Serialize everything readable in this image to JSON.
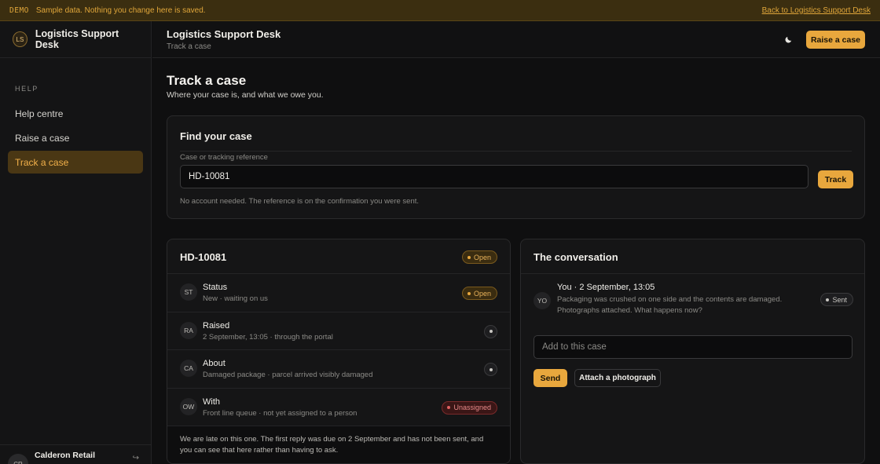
{
  "demo": {
    "tag": "DEMO",
    "text": "Sample data. Nothing you change here is saved.",
    "back_link": "Back to Logistics Support Desk"
  },
  "brand": {
    "initials": "LS",
    "name": "Logistics Support Desk"
  },
  "sidebar": {
    "heading": "HELP",
    "items": [
      {
        "label": "Help centre",
        "active": false
      },
      {
        "label": "Raise a case",
        "active": false
      },
      {
        "label": "Track a case",
        "active": true
      }
    ],
    "footer": {
      "initials": "CR",
      "name": "Calderon Retail",
      "icon": "exit-icon"
    }
  },
  "topbar": {
    "title": "Logistics Support Desk",
    "subtitle": "Track a case",
    "theme_icon": "moon-icon",
    "raise_label": "Raise a case"
  },
  "page": {
    "title": "Track a case",
    "subtitle": "Where your case is, and what we owe you."
  },
  "find": {
    "title": "Find your case",
    "field_label": "Case or tracking reference",
    "value": "HD-10081",
    "button": "Track",
    "hint": "No account needed. The reference is on the confirmation you were sent."
  },
  "case": {
    "ref": "HD-10081",
    "status_pill": "Open",
    "rows": [
      {
        "initials": "ST",
        "title": "Status",
        "sub": "New · waiting on us",
        "pill": "Open"
      },
      {
        "initials": "RA",
        "title": "Raised",
        "sub": "2 September, 13:05 · through the portal"
      },
      {
        "initials": "CA",
        "title": "About",
        "sub": "Damaged package · parcel arrived visibly damaged"
      },
      {
        "initials": "OW",
        "title": "With",
        "sub": "Front line queue · not yet assigned to a person",
        "pill": "Unassigned"
      }
    ],
    "late_note": "We are late on this one. The first reply was due on 2 September and has not been sent, and you can see that here rather than having to ask."
  },
  "conversation": {
    "title": "The conversation",
    "messages": [
      {
        "initials": "YO",
        "head": "You · 2 September, 13:05",
        "body": "Packaging was crushed on one side and the contents are damaged. Photographs attached. What happens now?",
        "pill": "Sent"
      }
    ],
    "input_placeholder": "Add to this case",
    "send_label": "Send",
    "attach_label": "Attach a photograph"
  },
  "colors": {
    "accent": "#e8a73d",
    "background": "#0f0f10",
    "danger": "#e06060"
  }
}
